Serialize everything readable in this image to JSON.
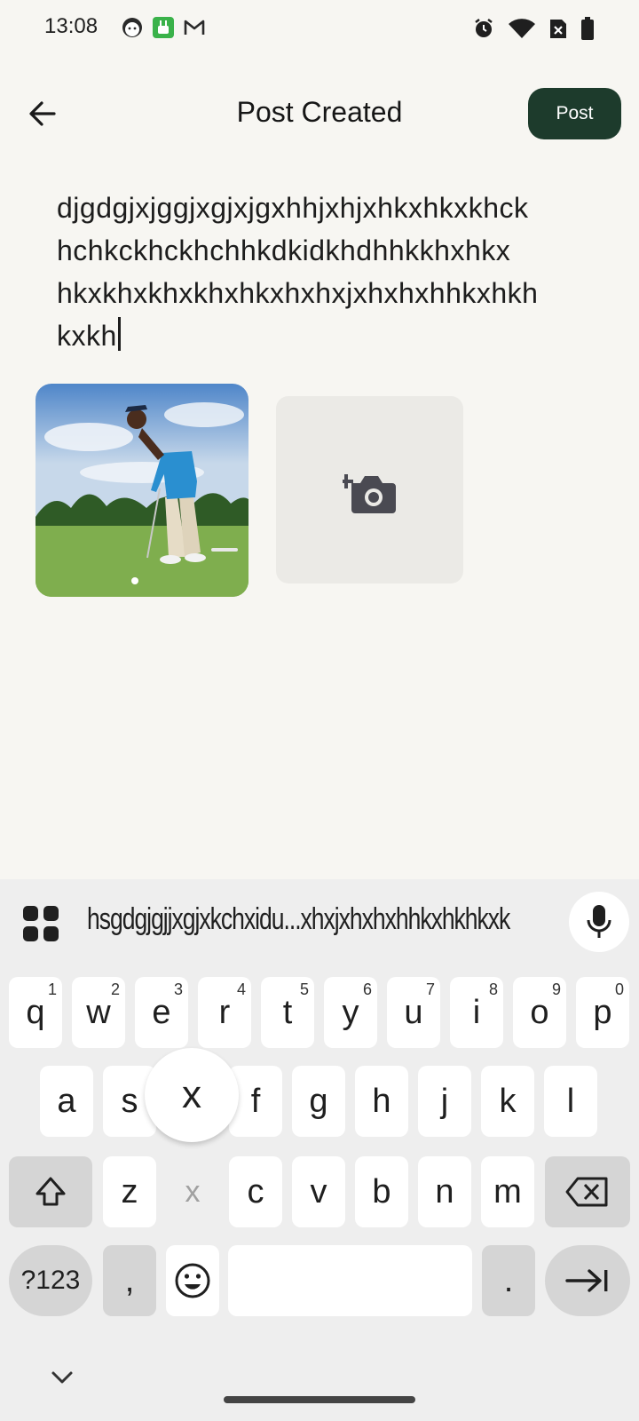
{
  "status_bar": {
    "time": "13:08",
    "left_icons": [
      "face-app-icon",
      "green-app-icon",
      "gmail-icon"
    ],
    "right_icons": [
      "alarm-icon",
      "wifi-icon",
      "no-sim-icon",
      "battery-icon"
    ]
  },
  "header": {
    "title": "Post Created",
    "post_label": "Post"
  },
  "post": {
    "text": "djgdgjxjggjxgjxjgxhhjxhjxhkxhkxkhck\nhchkckhckhchhkdkidkhdhhkkhxhkx\nhkxkhxkhxkhxhkxhxhxjxhxhxhhkxhkh\nkxkh"
  },
  "media": {
    "photo_alt": "golfer putting on green",
    "add_photo_icon": "add-photo-icon"
  },
  "keyboard": {
    "suggestion": "hsgdgjgjjxgjxkchxidu...xhxjxhxhxhhkxhkhkxk",
    "popup_key": "x",
    "row1": [
      {
        "k": "q",
        "h": "1"
      },
      {
        "k": "w",
        "h": "2"
      },
      {
        "k": "e",
        "h": "3"
      },
      {
        "k": "r",
        "h": "4"
      },
      {
        "k": "t",
        "h": "5"
      },
      {
        "k": "y",
        "h": "6"
      },
      {
        "k": "u",
        "h": "7"
      },
      {
        "k": "i",
        "h": "8"
      },
      {
        "k": "o",
        "h": "9"
      },
      {
        "k": "p",
        "h": "0"
      }
    ],
    "row2": [
      "a",
      "s",
      "x",
      "f",
      "g",
      "h",
      "j",
      "k",
      "l"
    ],
    "row3": [
      "z",
      "x",
      "c",
      "v",
      "b",
      "n",
      "m"
    ],
    "symbols_label": "?123",
    "comma": ",",
    "period": "."
  }
}
